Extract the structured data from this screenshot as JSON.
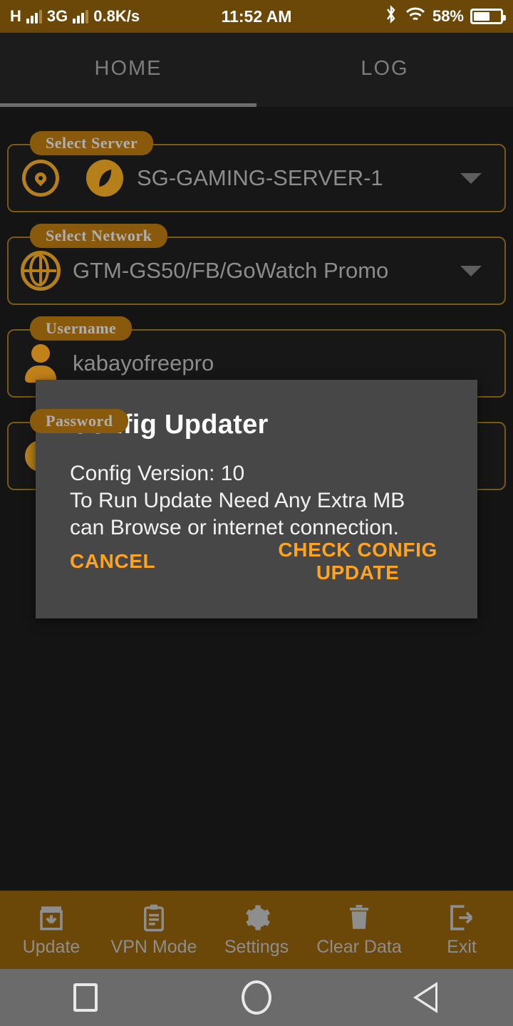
{
  "status_bar": {
    "network_type": "H",
    "mobile_network": "3G",
    "data_speed": "0.8K/s",
    "time": "11:52 AM",
    "battery_percent": "58%",
    "bluetooth_icon": "bluetooth-icon",
    "wifi_icon": "wifi-icon",
    "battery_icon": "battery-icon",
    "background_color": "#6B4708"
  },
  "tabs": [
    {
      "label": "HOME",
      "active": true
    },
    {
      "label": "LOG",
      "active": false
    }
  ],
  "form": {
    "fields": [
      {
        "label": "Select Server",
        "value": "SG-GAMING-SERVER-1",
        "icons": [
          "location-pin-icon",
          "leaf-icon"
        ],
        "has_caret": true
      },
      {
        "label": "Select Network",
        "value": "GTM-GS50/FB/GoWatch Promo",
        "icons": [
          "globe-icon"
        ],
        "has_caret": true
      },
      {
        "label": "Username",
        "value": "kabayofreepro",
        "icons": [
          "person-icon"
        ],
        "has_caret": false
      },
      {
        "label": "Password",
        "value": "",
        "icons": [
          "key-icon"
        ],
        "has_caret": false,
        "trailing_icon": "eye-visibility-icon"
      }
    ]
  },
  "dialog": {
    "title": "Config Updater",
    "body": "Config Version: 10\n To Run Update Need Any Extra MB\ncan Browse or internet connection.",
    "cancel_label": "CANCEL",
    "confirm_label": "CHECK CONFIG UPDATE",
    "accent_color": "#FFA41C",
    "background_color": "#474747"
  },
  "bottom_nav": [
    {
      "label": "Update",
      "icon": "download-box-icon"
    },
    {
      "label": "VPN Mode",
      "icon": "clipboard-icon"
    },
    {
      "label": "Settings",
      "icon": "gear-icon"
    },
    {
      "label": "Clear Data",
      "icon": "trash-icon"
    },
    {
      "label": "Exit",
      "icon": "exit-arrow-icon"
    }
  ],
  "system_nav": [
    {
      "name": "recents",
      "icon": "square-icon"
    },
    {
      "name": "home",
      "icon": "circle-icon"
    },
    {
      "name": "back",
      "icon": "triangle-back-icon"
    }
  ],
  "theme": {
    "brand_brown": "#6B4708",
    "accent_orange": "#B5801A",
    "page_background": "#141414"
  }
}
